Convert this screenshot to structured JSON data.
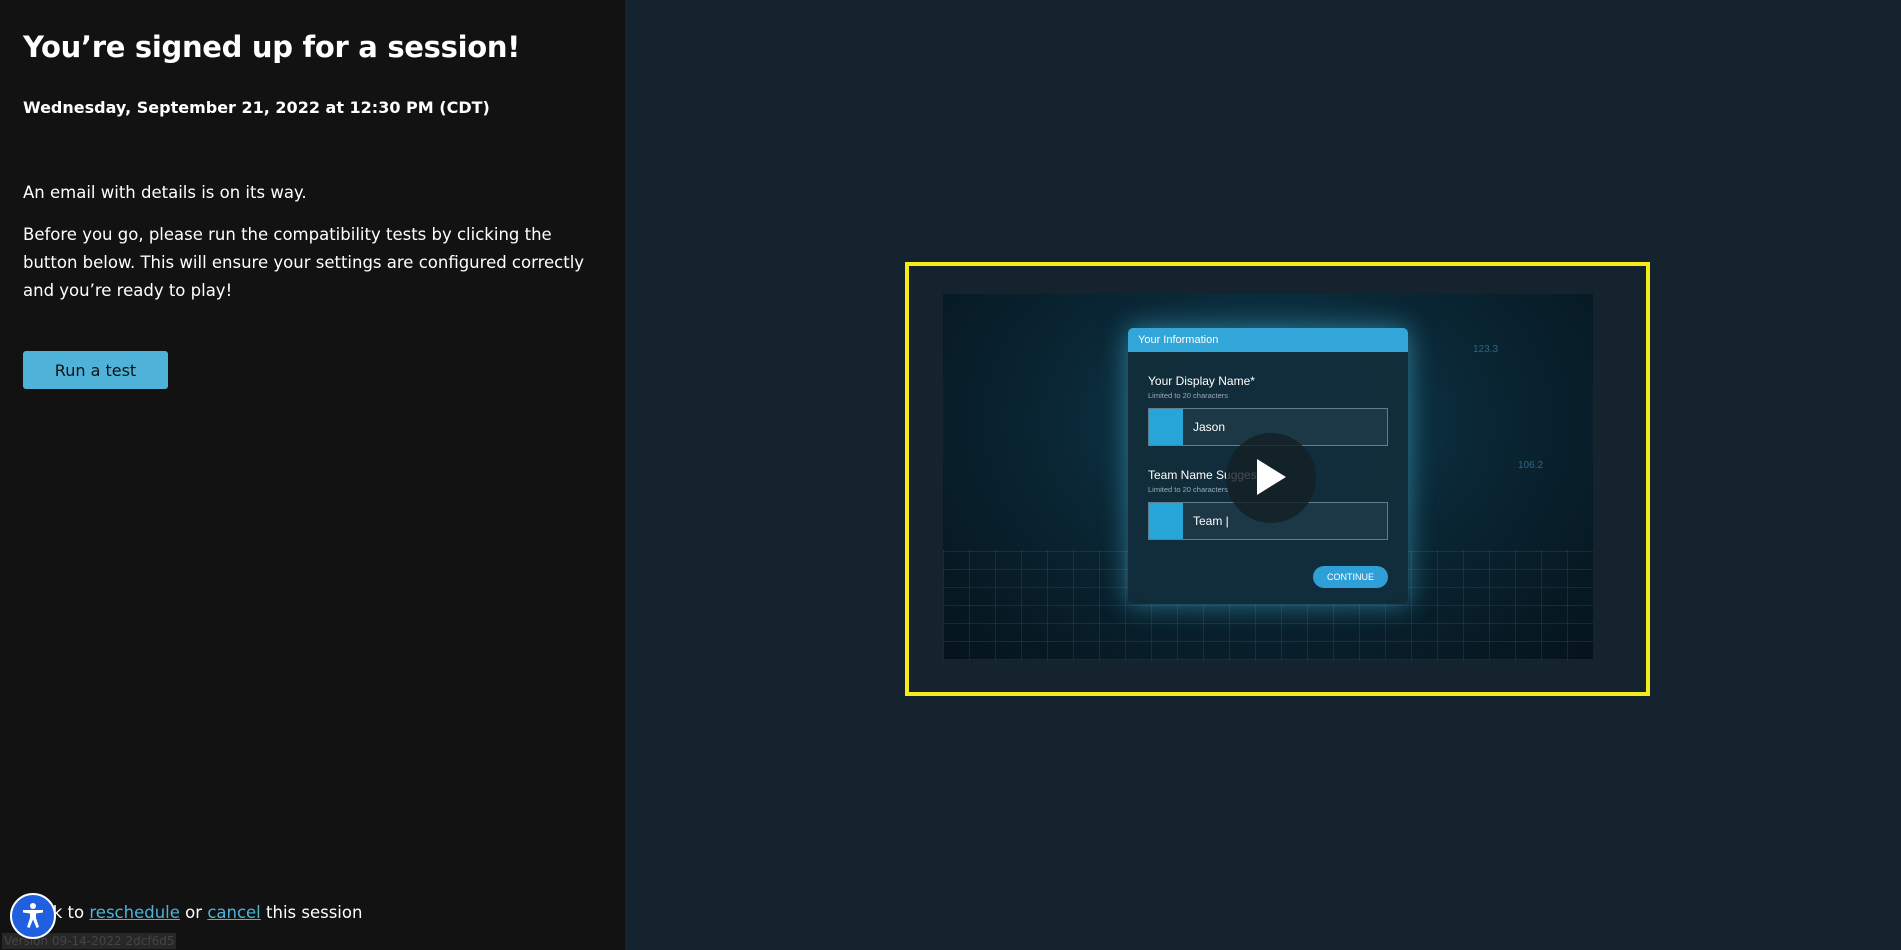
{
  "session": {
    "heading": "You’re signed up for a session!",
    "datetime": "Wednesday, September 21, 2022 at 12:30 PM (CDT)",
    "email_note": "An email with details is on its way.",
    "instructions": "Before you go, please run the compatibility tests by clicking the button below. This will ensure your settings are configured correctly and you’re ready to play!",
    "run_test_label": "Run a test"
  },
  "footer": {
    "prefix": "Click to",
    "reschedule_link": "reschedule",
    "or_text": "or",
    "cancel_link": "cancel",
    "suffix": "this session",
    "version": "Version 09-14-2022 2dcf6d5"
  },
  "video": {
    "card_title": "Your Information",
    "display_name_label": "Your Display Name*",
    "display_name_hint": "Limited to 20 characters",
    "display_name_value": "Jason",
    "team_name_label": "Team Name Suggestion",
    "team_name_hint": "Limited to 20 characters",
    "team_name_value": "Team |",
    "continue_label": "CONTINUE",
    "deco_1": "123.3",
    "deco_2": "106.2"
  },
  "colors": {
    "accent": "#4fb3d9",
    "left_panel": "#121212",
    "right_panel": "#15232f",
    "video_border": "#f6ec19",
    "a11y_button": "#1f5fe0"
  },
  "icons": {
    "play": "play-icon",
    "accessibility": "accessibility-icon"
  }
}
